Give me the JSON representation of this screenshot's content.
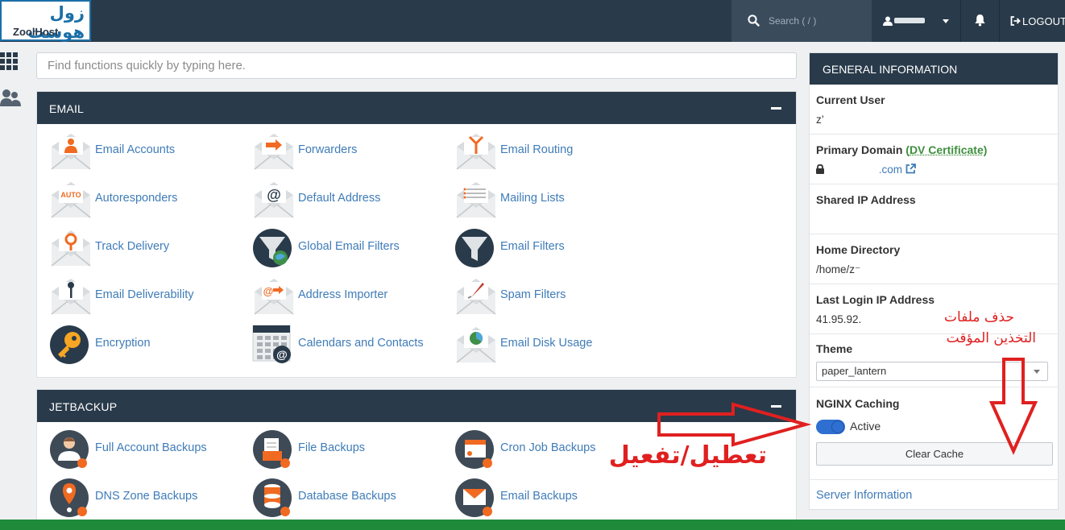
{
  "logo": {
    "arabic": "زول هوست",
    "english": "ZoolHost"
  },
  "topbar": {
    "search_placeholder": "Search ( / )",
    "logout_label": "LOGOUT"
  },
  "find": {
    "placeholder": "Find functions quickly by typing here."
  },
  "email": {
    "title": "EMAIL",
    "items": [
      {
        "label": "Email Accounts",
        "icon": "email-accounts-icon"
      },
      {
        "label": "Forwarders",
        "icon": "forwarders-icon"
      },
      {
        "label": "Email Routing",
        "icon": "email-routing-icon"
      },
      {
        "label": "Autoresponders",
        "icon": "autoresponders-icon"
      },
      {
        "label": "Default Address",
        "icon": "default-address-icon"
      },
      {
        "label": "Mailing Lists",
        "icon": "mailing-lists-icon"
      },
      {
        "label": "Track Delivery",
        "icon": "track-delivery-icon"
      },
      {
        "label": "Global Email Filters",
        "icon": "global-email-filters-icon"
      },
      {
        "label": "Email Filters",
        "icon": "email-filters-icon"
      },
      {
        "label": "Email Deliverability",
        "icon": "email-deliverability-icon"
      },
      {
        "label": "Address Importer",
        "icon": "address-importer-icon"
      },
      {
        "label": "Spam Filters",
        "icon": "spam-filters-icon"
      },
      {
        "label": "Encryption",
        "icon": "encryption-icon"
      },
      {
        "label": "Calendars and Contacts",
        "icon": "calendars-contacts-icon"
      },
      {
        "label": "Email Disk Usage",
        "icon": "email-disk-usage-icon"
      }
    ]
  },
  "jetbackup": {
    "title": "JETBACKUP",
    "items": [
      {
        "label": "Full Account Backups",
        "icon": "full-account-backups-icon"
      },
      {
        "label": "File Backups",
        "icon": "file-backups-icon"
      },
      {
        "label": "Cron Job Backups",
        "icon": "cron-job-backups-icon"
      },
      {
        "label": "DNS Zone Backups",
        "icon": "dns-zone-backups-icon"
      },
      {
        "label": "Database Backups",
        "icon": "database-backups-icon"
      },
      {
        "label": "Email Backups",
        "icon": "email-backups-icon"
      }
    ]
  },
  "general": {
    "title": "GENERAL INFORMATION",
    "current_user_label": "Current User",
    "current_user_value": "z’",
    "primary_domain_label": "Primary Domain",
    "primary_domain_paren_open": "(",
    "primary_domain_cert": "DV Certificate",
    "primary_domain_paren_close": ")",
    "primary_domain_value": ".com",
    "shared_ip_label": "Shared IP Address",
    "home_dir_label": "Home Directory",
    "home_dir_value": "/home/z⁻",
    "last_login_label": "Last Login IP Address",
    "last_login_value": "41.95.92.",
    "theme_label": "Theme",
    "theme_value": "paper_lantern",
    "nginx_label": "NGINX Caching",
    "nginx_status": "Active",
    "clear_cache_label": "Clear Cache",
    "server_info_label": "Server Information"
  },
  "annotations": {
    "delete_cache_line1": "حذف ملفات",
    "delete_cache_line2": "التخذين المؤقت",
    "toggle_note": "تعطيل/تفعيل"
  },
  "colors": {
    "topbar": "#293a4a",
    "link": "#3f7cb8",
    "annotation": "#e02020",
    "toggle": "#2f6fd1"
  }
}
